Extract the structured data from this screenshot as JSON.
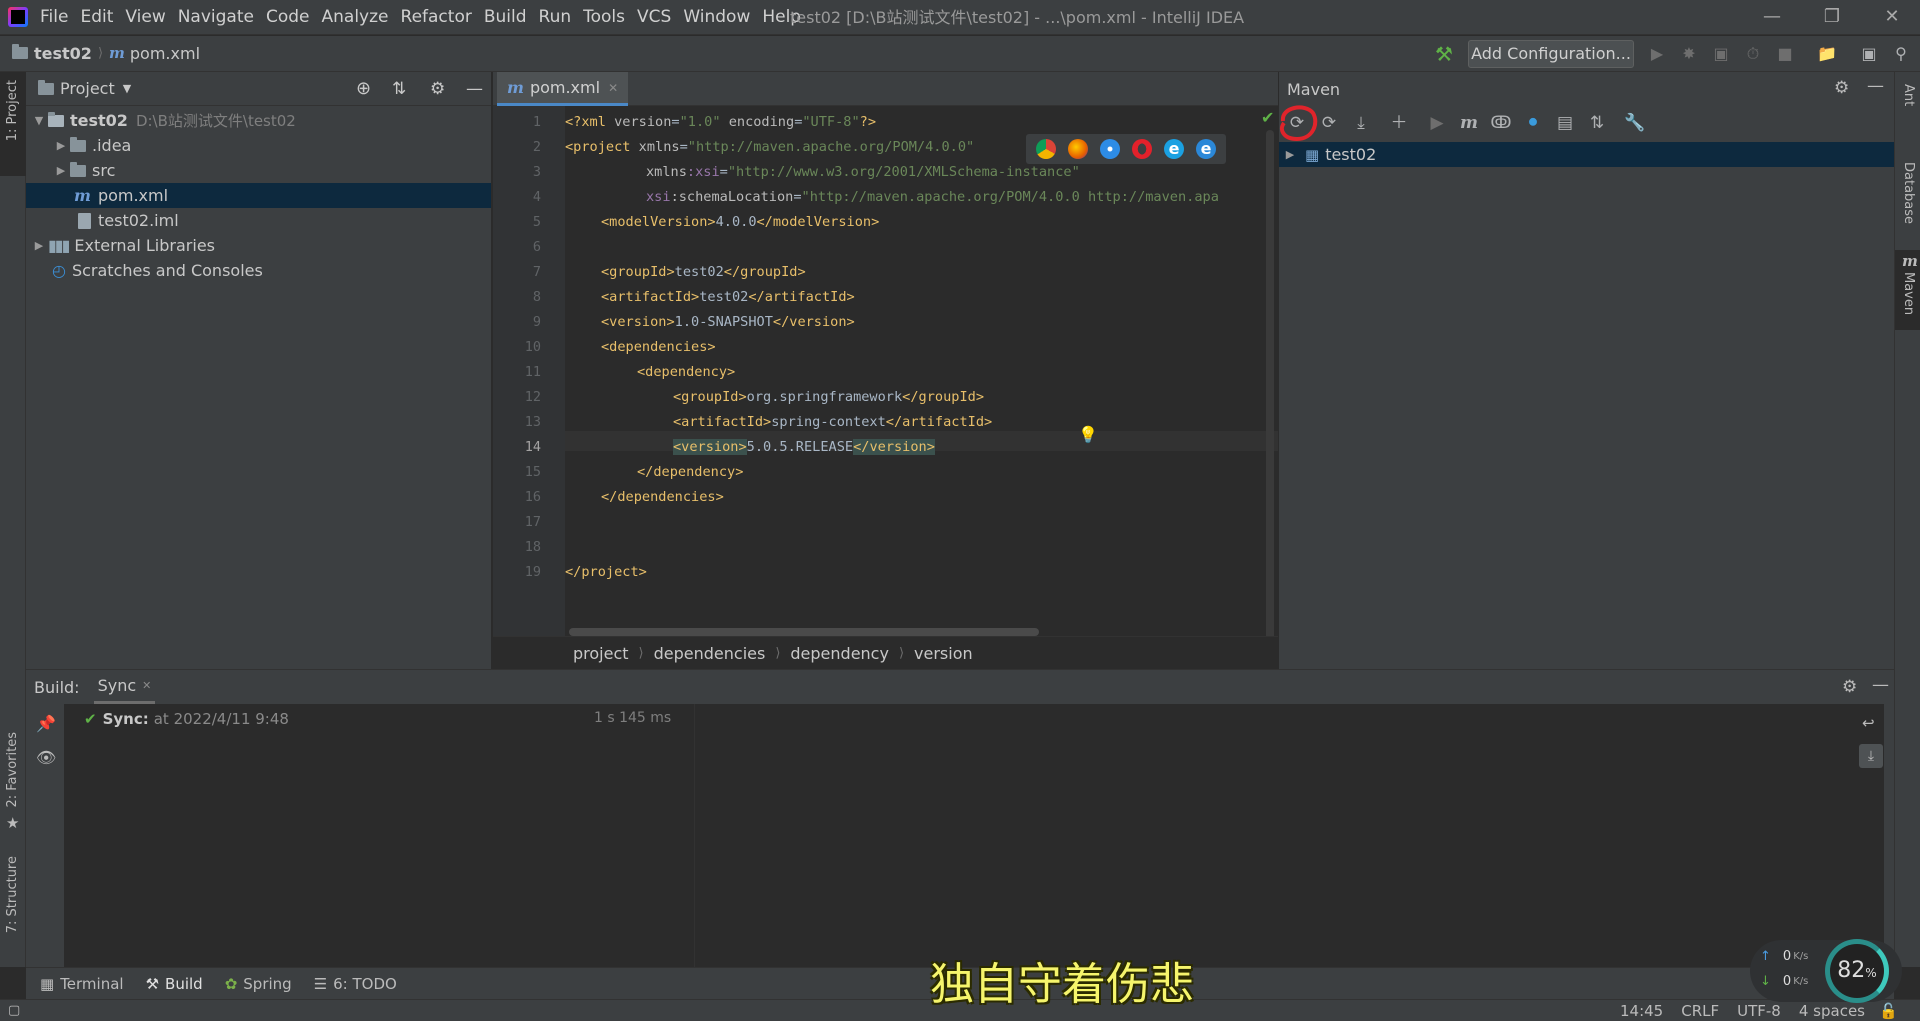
{
  "app": {
    "window_title": "test02 [D:\\B站测试文件\\test02] - ...\\pom.xml - IntelliJ IDEA",
    "menu": [
      "File",
      "Edit",
      "View",
      "Navigate",
      "Code",
      "Analyze",
      "Refactor",
      "Build",
      "Run",
      "Tools",
      "VCS",
      "Window",
      "Help"
    ]
  },
  "nav": {
    "project": "test02",
    "file": "pom.xml",
    "add_configuration": "Add Configuration..."
  },
  "left_strip": {
    "project_tab": "1: Project",
    "favorites_tab": "2: Favorites",
    "structure_tab": "7: Structure"
  },
  "right_strip": {
    "ant": "Ant",
    "database": "Database",
    "maven": "Maven"
  },
  "project_panel": {
    "title": "Project",
    "tree": [
      {
        "label": "test02",
        "hint": "D:\\B站测试文件\\test02"
      },
      {
        "label": ".idea"
      },
      {
        "label": "src"
      },
      {
        "label": "pom.xml"
      },
      {
        "label": "test02.iml"
      },
      {
        "label": "External Libraries"
      },
      {
        "label": "Scratches and Consoles"
      }
    ]
  },
  "editor": {
    "tab": "pom.xml",
    "line_numbers": [
      "1",
      "2",
      "3",
      "4",
      "5",
      "6",
      "7",
      "8",
      "9",
      "10",
      "11",
      "12",
      "13",
      "14",
      "15",
      "16",
      "17",
      "18",
      "19"
    ],
    "lines": {
      "l1a": "<?xml ",
      "l1b": "version",
      "l1c": "=",
      "l1d": "\"1.0\"",
      "l1e": " encoding",
      "l1f": "=",
      "l1g": "\"UTF-8\"",
      "l1h": "?>",
      "l2a": "<project ",
      "l2b": "xmlns",
      "l2c": "=",
      "l2d": "\"http://maven.apache.org/POM/4.0.0\"",
      "l3a": "xmlns",
      "l3b": ":xsi",
      "l3c": "=",
      "l3d": "\"http://www.w3.org/2001/XMLSchema-instance\"",
      "l4a": "xsi",
      "l4b": ":schemaLocation",
      "l4c": "=",
      "l4d": "\"http://maven.apache.org/POM/4.0.0 http://maven.apa",
      "l5a": "<modelVersion>",
      "l5b": "4.0.0",
      "l5c": "</modelVersion>",
      "l7a": "<groupId>",
      "l7b": "test02",
      "l7c": "</groupId>",
      "l8a": "<artifactId>",
      "l8b": "test02",
      "l8c": "</artifactId>",
      "l9a": "<version>",
      "l9b": "1.0-SNAPSHOT",
      "l9c": "</version>",
      "l10": "<dependencies>",
      "l11": "<dependency>",
      "l12a": "<groupId>",
      "l12b": "org.springframework",
      "l12c": "</groupId>",
      "l13a": "<artifactId>",
      "l13b": "spring-context",
      "l13c": "</artifactId>",
      "l14a": "<version>",
      "l14b": "5.0.5.RELEASE",
      "l14c": "</version>",
      "l15": "</dependency>",
      "l16": "</dependencies>",
      "l19": "</project>"
    },
    "breadcrumbs": [
      "project",
      "dependencies",
      "dependency",
      "version"
    ]
  },
  "maven": {
    "title": "Maven",
    "project": "test02"
  },
  "build": {
    "label": "Build:",
    "tab": "Sync",
    "sync_title": "Sync:",
    "sync_time": "at 2022/4/11 9:48",
    "duration": "1 s 145 ms"
  },
  "bottom_tabs": [
    "Terminal",
    "Build",
    "Spring",
    "6: TODO"
  ],
  "status": {
    "position": "14:45",
    "line_sep": "CRLF",
    "encoding": "UTF-8",
    "indent": "4 spaces"
  },
  "overlay": {
    "subtitle": "独自守着伤悲",
    "up_speed": "0",
    "down_speed": "0",
    "speed_unit": "K/s",
    "cpu": "82",
    "cpu_unit": "%"
  },
  "colors": {
    "accent": "#4a88c7",
    "selection": "#0d293e",
    "subtitle": "#f6f56c",
    "annotation_circle": "#e0242b"
  }
}
